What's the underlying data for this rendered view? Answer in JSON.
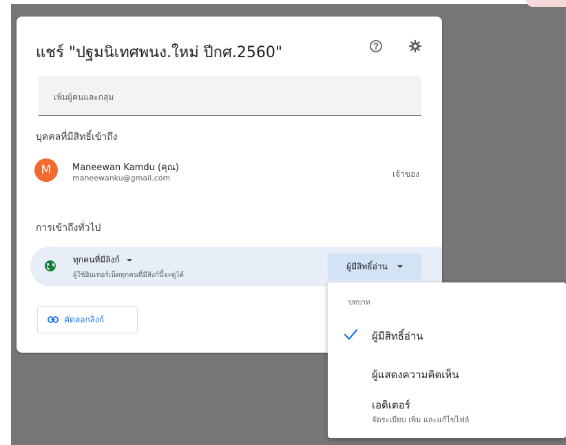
{
  "dialog": {
    "title": "แชร์ \"ปฐมนิเทศพนง.ใหม่ ปีกศ.2560\"",
    "help_icon": "help-circle-icon",
    "settings_icon": "gear-icon",
    "add_people_placeholder": "เพิ่มผู้คนและกลุ่ม"
  },
  "people_section": {
    "heading": "บุคคลที่มีสิทธิ์เข้าถึง",
    "people": [
      {
        "avatar_letter": "M",
        "avatar_color": "#f26a30",
        "name": "Maneewan Kamdu (คุณ)",
        "email": "maneewanku@gmail.com",
        "role": "เจ้าของ"
      }
    ]
  },
  "general_access": {
    "heading": "การเข้าถึงทั่วไป",
    "icon": "globe-icon",
    "scope": "ทุกคนที่มีลิงก์",
    "description": "ผู้ใช้อินเทอร์เน็ตทุกคนที่มีลิงก์นี้จะดูได้",
    "role": "ผู้มีสิทธิ์อ่าน"
  },
  "copy_link": {
    "icon": "link-icon",
    "label": "คัดลอกลิงก์"
  },
  "role_menu": {
    "title": "บทบาท",
    "items": [
      {
        "label": "ผู้มีสิทธิ์อ่าน",
        "selected": true
      },
      {
        "label": "ผู้แสดงความคิดเห็น",
        "selected": false
      },
      {
        "label": "เอดิเตอร์",
        "subtitle": "จัดระเบียบ เพิ่ม และแก้ไขไฟล์",
        "selected": false
      }
    ]
  },
  "colors": {
    "accent": "#1a73e8",
    "backdrop": "#767676",
    "selected_row": "#e8eef8",
    "role_button": "#d3e2f5"
  }
}
